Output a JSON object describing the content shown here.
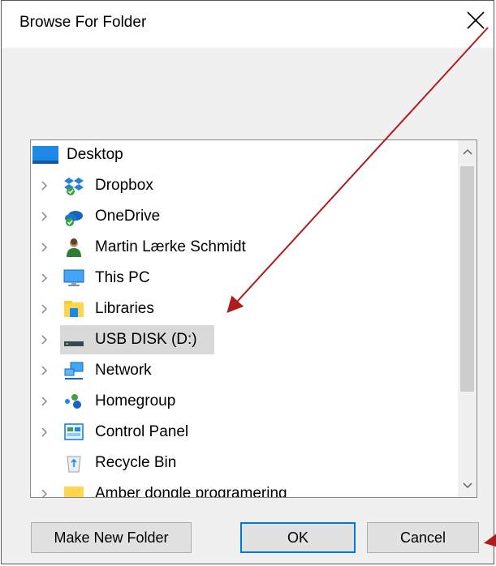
{
  "dialog": {
    "title": "Browse For Folder",
    "close_symbol": "✕"
  },
  "tree": {
    "root": {
      "label": "Desktop",
      "icon": "desktop-icon"
    },
    "items": [
      {
        "label": "Dropbox",
        "icon": "dropbox-icon",
        "expandable": true
      },
      {
        "label": "OneDrive",
        "icon": "onedrive-icon",
        "expandable": true
      },
      {
        "label": "Martin Lærke Schmidt",
        "icon": "user-icon",
        "expandable": true
      },
      {
        "label": "This PC",
        "icon": "computer-icon",
        "expandable": true
      },
      {
        "label": "Libraries",
        "icon": "libraries-icon",
        "expandable": true
      },
      {
        "label": "USB DISK (D:)",
        "icon": "usb-drive-icon",
        "expandable": true,
        "selected": true
      },
      {
        "label": "Network",
        "icon": "network-icon",
        "expandable": true
      },
      {
        "label": "Homegroup",
        "icon": "homegroup-icon",
        "expandable": true
      },
      {
        "label": "Control Panel",
        "icon": "control-panel-icon",
        "expandable": true
      },
      {
        "label": "Recycle Bin",
        "icon": "recycle-bin-icon",
        "expandable": false
      },
      {
        "label": "Amber dongle programering",
        "icon": "folder-icon",
        "expandable": true
      }
    ],
    "scroll_up_symbol": "︿",
    "scroll_down_symbol": "﹀"
  },
  "buttons": {
    "make_new_folder": "Make New Folder",
    "ok": "OK",
    "cancel": "Cancel"
  },
  "colors": {
    "annotation_arrow": "#b01c1c",
    "ok_focus_border": "#0078d7",
    "selection": "#d9d9d9"
  }
}
